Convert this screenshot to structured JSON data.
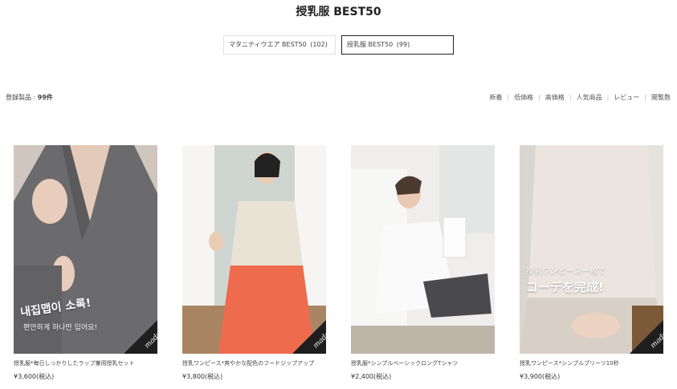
{
  "page": {
    "title": "授乳服 BEST50"
  },
  "tabs": [
    {
      "label": "マタニティウエア BEST50",
      "count": "(102)"
    },
    {
      "label": "授乳服 BEST50",
      "count": "(99)"
    }
  ],
  "listing": {
    "count_label": "登録製品 : ",
    "count_value": "99件"
  },
  "sort_options": [
    "新着",
    "低価格",
    "高価格",
    "人気商品",
    "レビュー",
    "閲覧数"
  ],
  "products": [
    {
      "name": "授乳服*毎日しっかりしたラップ兼用授乳セット",
      "price": "¥3,600(税込)",
      "overlay_lines": [
        "내집맵이 소록!",
        "편안하게 하나만 입어요!"
      ],
      "badge": "made"
    },
    {
      "name": "授乳ワンピース*爽やかな配色のフードジップアップ",
      "price": "¥3,800(税込)",
      "overlay_lines": [],
      "badge": "made"
    },
    {
      "name": "授乳服*シンプルベーシックロングTシャツ",
      "price": "¥2,400(税込)",
      "overlay_lines": [],
      "badge": ""
    },
    {
      "name": "授乳ワンピース*シンプルプリーツ10秒",
      "price": "¥3,900(税込)",
      "overlay_lines": [
        "授乳ワンピース一枚で",
        "コーデを完成!"
      ],
      "badge": "made"
    }
  ],
  "colors": {
    "active_tab_border": "#222222",
    "inactive_tab_border": "#e2e2e2"
  }
}
